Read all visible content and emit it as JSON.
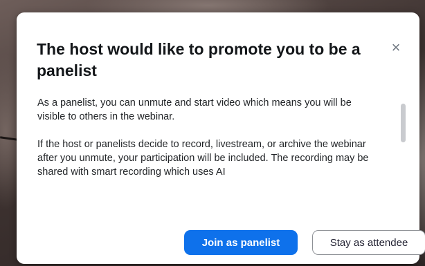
{
  "dialog": {
    "title": "The host would like to promote you to be a panelist",
    "close_label": "×",
    "paragraphs": [
      "As a panelist, you can unmute and start video which means you will be visible to others in the webinar.",
      "If the host or panelists decide to record, livestream, or archive the webinar after you unmute, your participation will be included. The recording may be shared with smart recording which uses AI"
    ],
    "primary_button_label": "Join as panelist",
    "secondary_button_label": "Stay as attendee"
  },
  "colors": {
    "primary": "#0e71eb",
    "title_text": "#131619",
    "body_text": "#222528"
  },
  "icons": {
    "close": "close-icon"
  }
}
